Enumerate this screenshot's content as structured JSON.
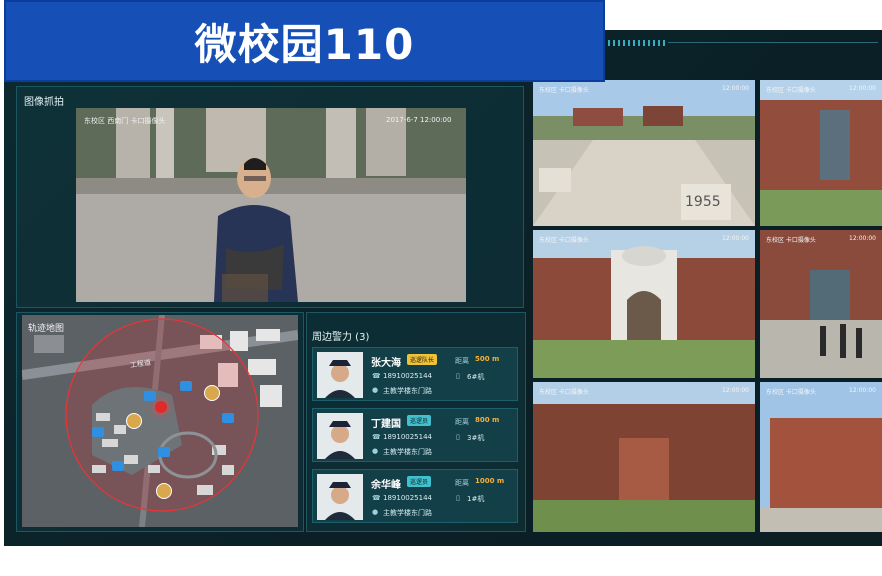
{
  "banner": {
    "title": "微校园110"
  },
  "capture": {
    "title": "图像抓拍",
    "location": "东校区 西南门 卡口摄像头",
    "timestamp": "2017-6-7 12:00:00"
  },
  "map": {
    "title": "轨迹地图",
    "road_label": "工程道"
  },
  "officers": {
    "title": "周边警力 (3)",
    "dist_label": "距离",
    "items": [
      {
        "name": "张大海",
        "badge": "巡逻队长",
        "badge_color": "#f0c238",
        "distance": "500 m",
        "phone": "18910025144",
        "device": "6#机",
        "location": "主教学楼东门路"
      },
      {
        "name": "丁建国",
        "badge": "巡逻员",
        "badge_color": "#3fc1d0",
        "distance": "800 m",
        "phone": "18910025144",
        "device": "3#机",
        "location": "主教学楼东门路"
      },
      {
        "name": "余华峰",
        "badge": "巡逻员",
        "badge_color": "#3fc1d0",
        "distance": "1000 m",
        "phone": "18910025144",
        "device": "1#机",
        "location": "主教学楼东门路"
      }
    ]
  },
  "cameras": [
    {
      "label": "东校区 卡口摄像头",
      "time": "12:00:00"
    },
    {
      "label": "东校区 卡口摄像头",
      "time": "12:00:00"
    },
    {
      "label": "东校区 卡口摄像头",
      "time": "12:00:00"
    },
    {
      "label": "东校区 卡口摄像头",
      "time": "12:00:00"
    },
    {
      "label": "东校区 卡口摄像头",
      "time": "12:00:00"
    },
    {
      "label": "东校区 卡口摄像头",
      "time": "12:00:00"
    }
  ],
  "monument_text": "1955",
  "colors": {
    "banner": "#1650b6",
    "screen": "#0d2a31",
    "accent": "#3fd0e4",
    "distance": "#f2b13a",
    "alert": "#e02a2a"
  }
}
